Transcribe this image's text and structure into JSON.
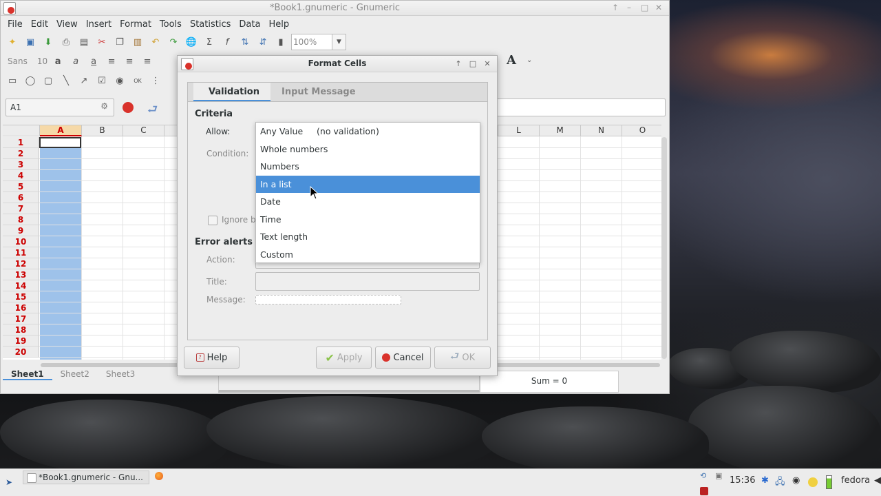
{
  "main_window": {
    "title": "*Book1.gnumeric - Gnumeric",
    "menu": [
      "File",
      "Edit",
      "View",
      "Insert",
      "Format",
      "Tools",
      "Statistics",
      "Data",
      "Help"
    ],
    "font_name": "Sans",
    "font_size": "10",
    "zoom": "100%",
    "name_box": "A1",
    "columns": [
      "A",
      "B",
      "C",
      "L",
      "M",
      "N",
      "O"
    ],
    "rows": [
      "1",
      "2",
      "3",
      "4",
      "5",
      "6",
      "7",
      "8",
      "9",
      "10",
      "11",
      "12",
      "13",
      "14",
      "15",
      "16",
      "17",
      "18",
      "19",
      "20"
    ],
    "sheets": [
      "Sheet1",
      "Sheet2",
      "Sheet3"
    ],
    "status_sum": "Sum = 0"
  },
  "dialog": {
    "title": "Format Cells",
    "tabs": [
      "Validation",
      "Input Message"
    ],
    "criteria_heading": "Criteria",
    "allow_label": "Allow:",
    "condition_label": "Condition:",
    "ignore_blank_label": "Ignore b",
    "error_alerts_heading": "Error alerts",
    "action_label": "Action:",
    "title_label": "Title:",
    "message_label": "Message:",
    "allow_options": [
      "Any Value     (no validation)",
      "Whole numbers",
      "Numbers",
      "In a list",
      "Date",
      "Time",
      "Text length",
      "Custom"
    ],
    "selected_index": 3,
    "buttons": {
      "help": "Help",
      "apply": "Apply",
      "cancel": "Cancel",
      "ok": "OK"
    }
  },
  "taskbar": {
    "task_label": "*Book1.gnumeric - Gnu...",
    "time": "15:36",
    "user": "fedora"
  },
  "colors": {
    "accent": "#4a90d9",
    "selection": "#9ec2ea",
    "row_header_text": "#cc0000"
  }
}
